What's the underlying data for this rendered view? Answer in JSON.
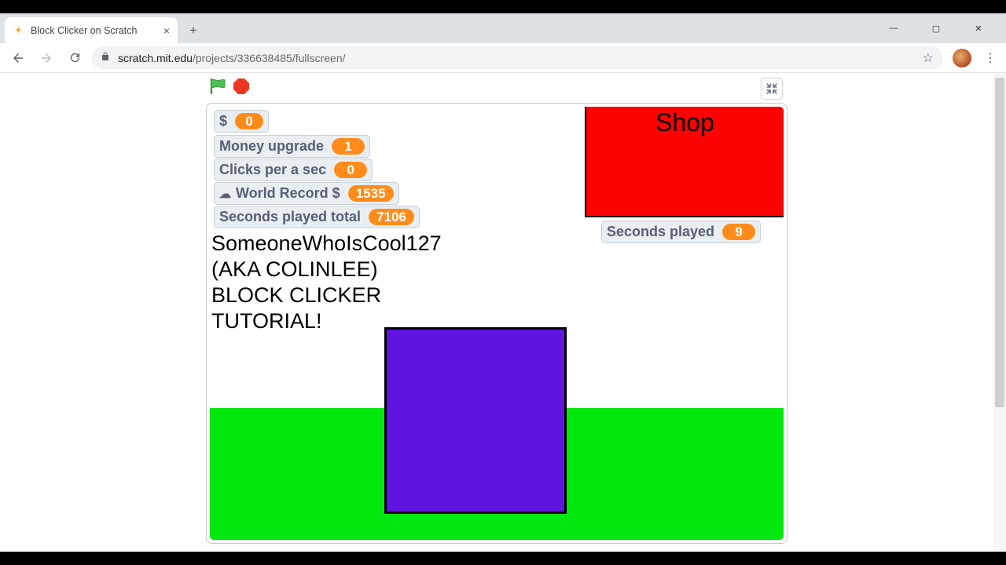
{
  "browser": {
    "tab_title": "Block Clicker on Scratch",
    "url_host": "scratch.mit.edu",
    "url_path": "/projects/336638485/fullscreen/"
  },
  "game": {
    "shop_label": "Shop",
    "credits_line1": "SomeoneWhoIsCool127",
    "credits_line2": "(AKA COLINLEE)",
    "credits_line3": "BLOCK CLICKER",
    "credits_line4": "TUTORIAL!",
    "monitors": {
      "money": {
        "label": "$",
        "value": "0"
      },
      "upgrade": {
        "label": "Money upgrade",
        "value": "1"
      },
      "cps": {
        "label": "Clicks per a sec",
        "value": "0"
      },
      "record": {
        "label": "World Record $",
        "value": "1535"
      },
      "total": {
        "label": "Seconds played total",
        "value": "7106"
      },
      "sec": {
        "label": "Seconds played",
        "value": "9"
      }
    }
  }
}
